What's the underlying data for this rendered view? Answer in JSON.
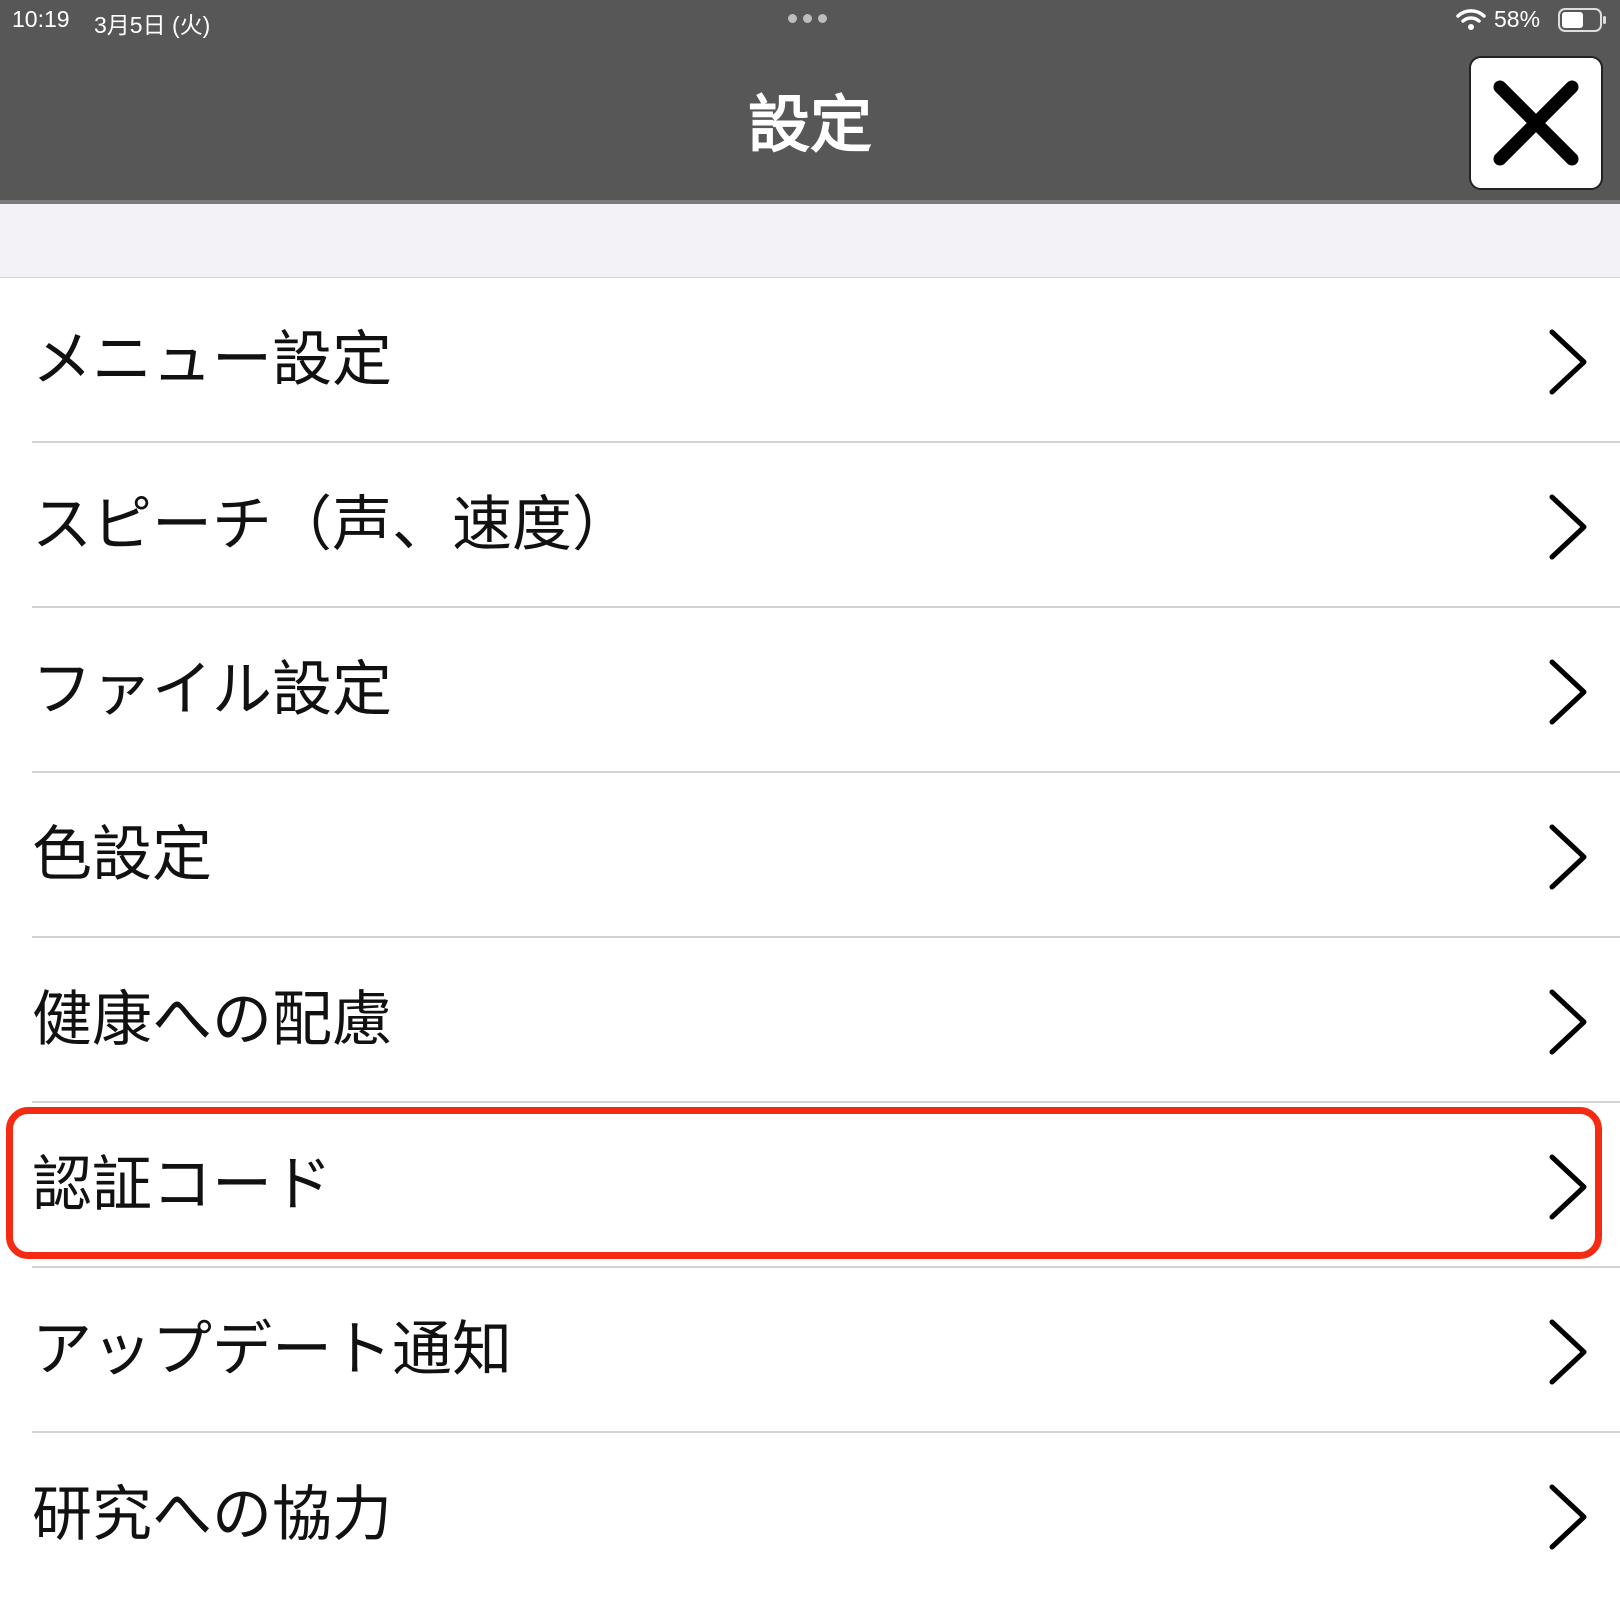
{
  "status_bar": {
    "time": "10:19",
    "date": "3月5日 (火)",
    "battery": "58%",
    "battery_level": 0.58
  },
  "header": {
    "title": "設定",
    "close_icon": "close-x-icon"
  },
  "menu": {
    "items": [
      {
        "label": "メニュー設定"
      },
      {
        "label": "スピーチ（声、速度）"
      },
      {
        "label": "ファイル設定"
      },
      {
        "label": "色設定"
      },
      {
        "label": "健康への配慮"
      },
      {
        "label": "認証コード",
        "highlighted": true
      },
      {
        "label": "アップデート通知"
      },
      {
        "label": "研究への協力"
      }
    ],
    "chevron_icon": "chevron-right-icon"
  },
  "colors": {
    "header_bg": "#575757",
    "highlight": "#f42a13",
    "spacer_bg": "#f2f2f7"
  }
}
